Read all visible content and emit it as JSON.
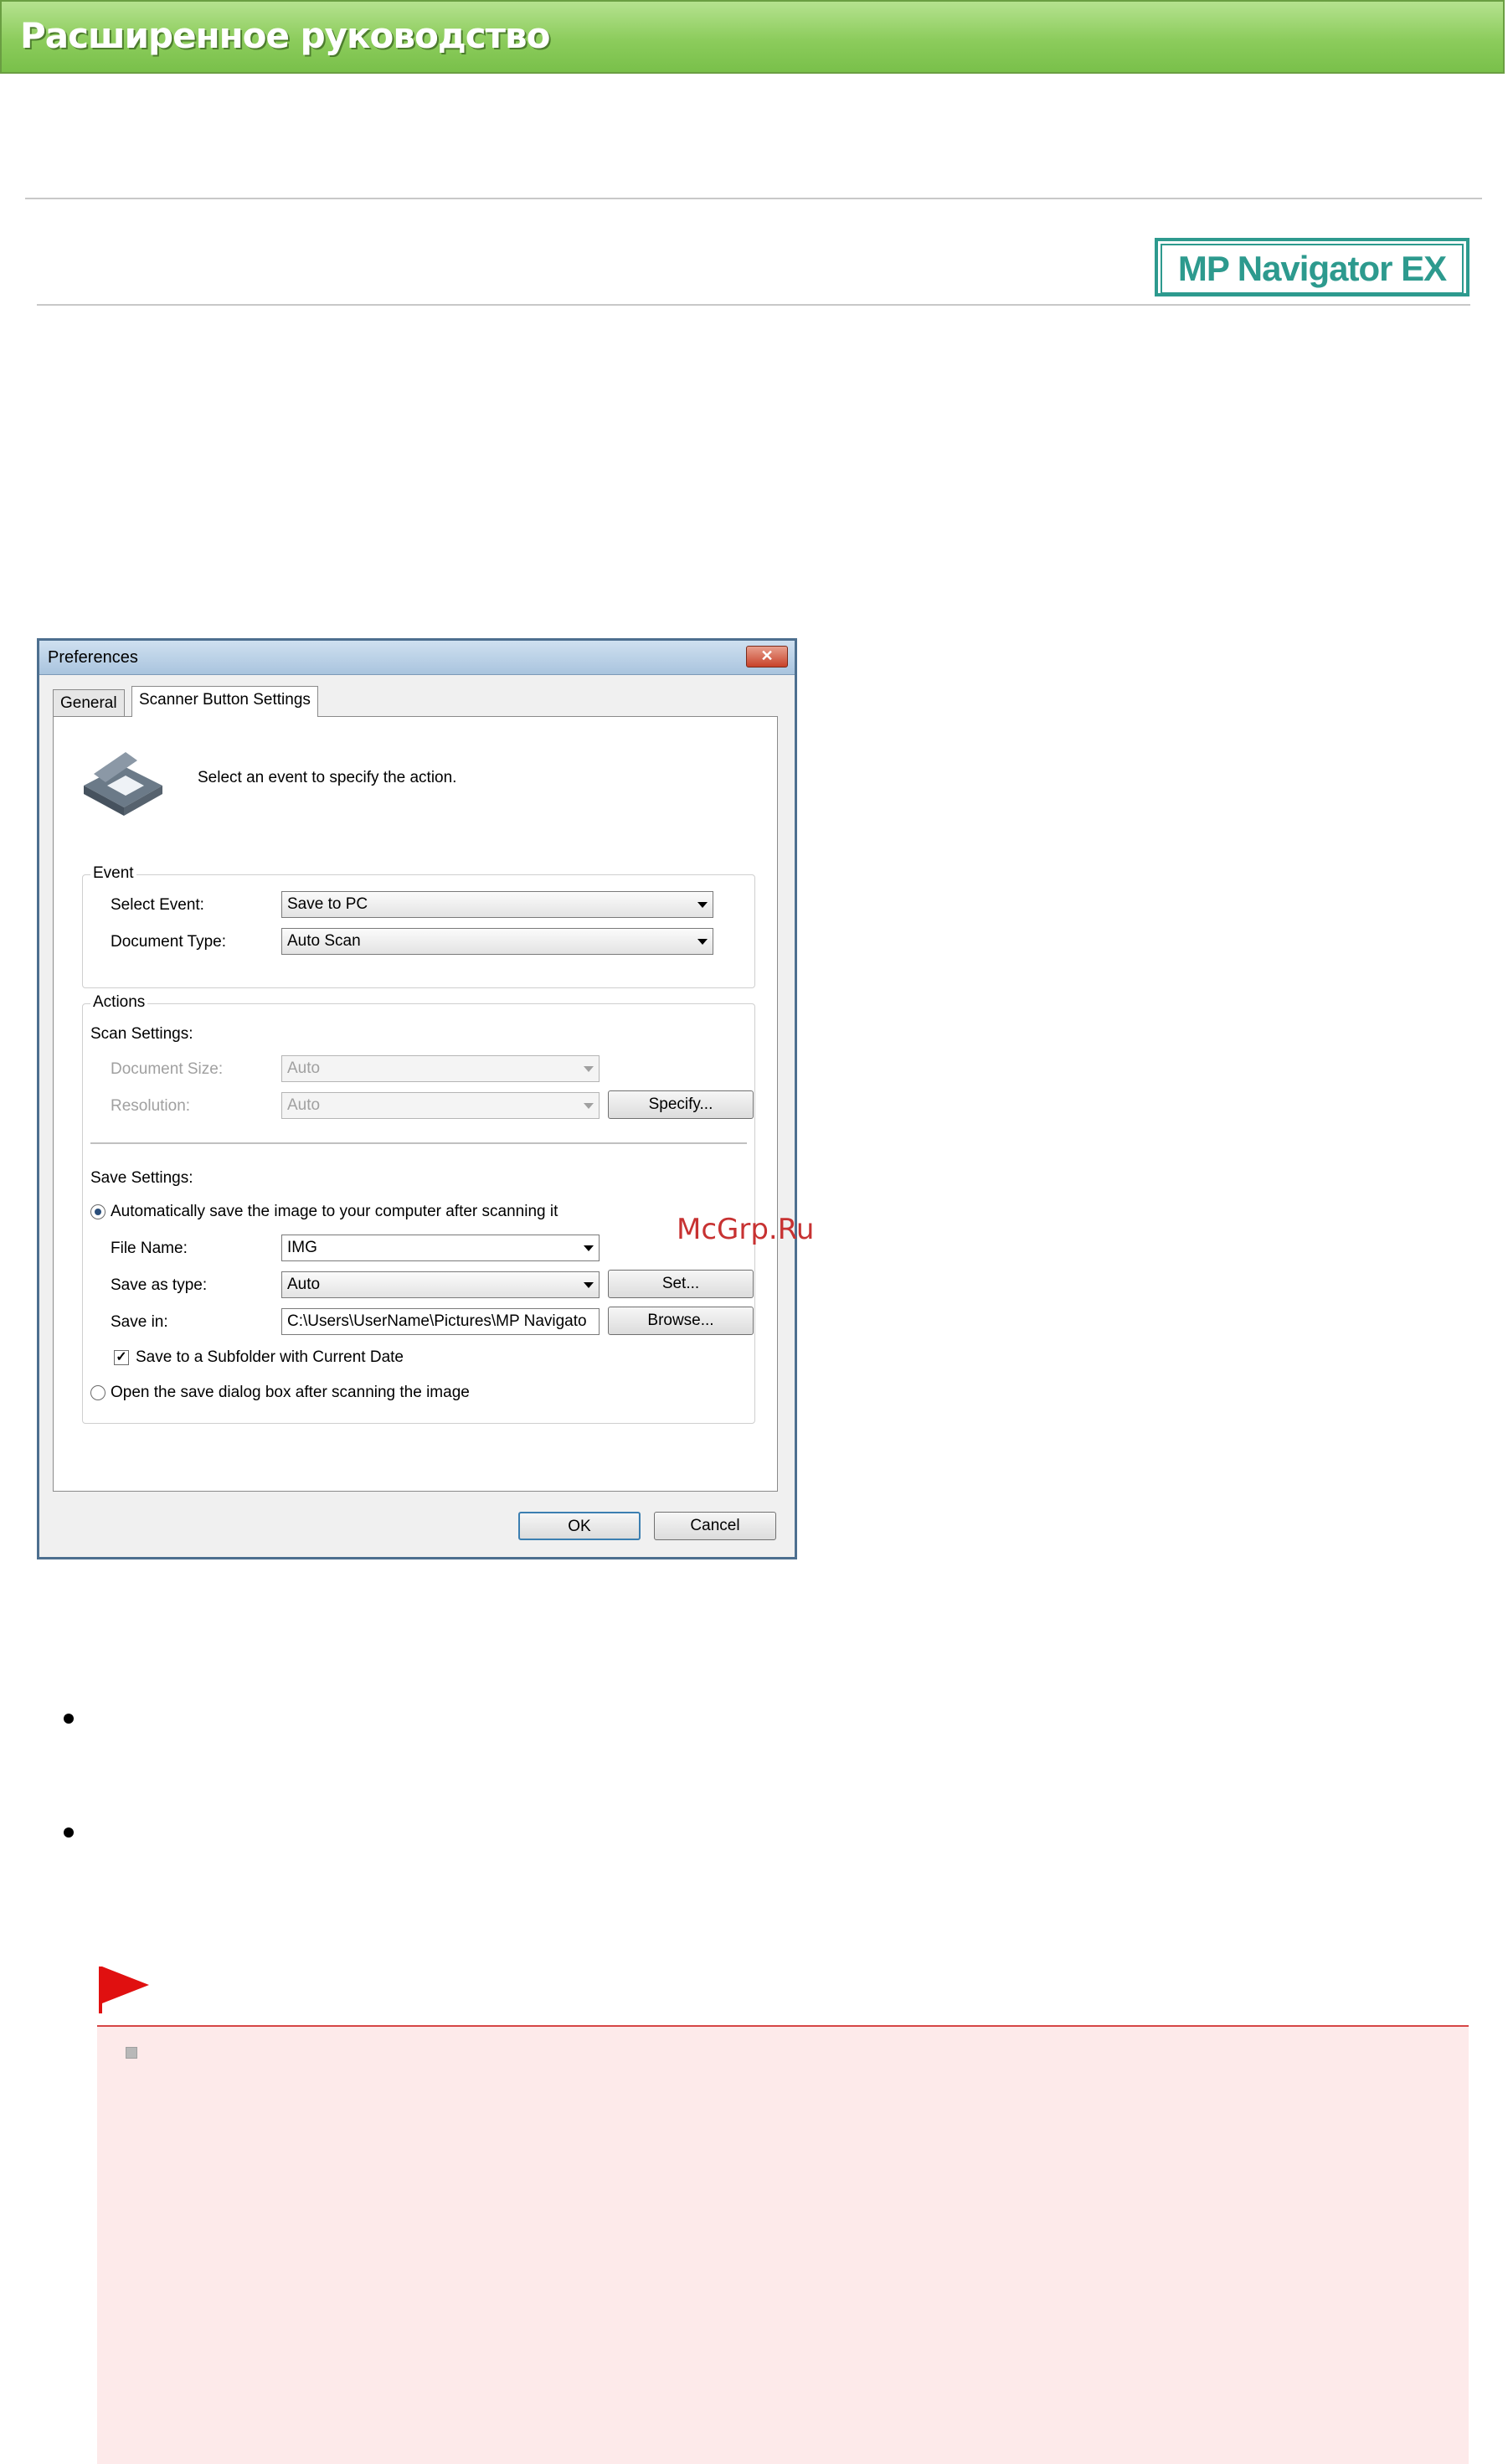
{
  "header": {
    "title": "Расширенное руководство"
  },
  "logo": {
    "text": "MP Navigator EX"
  },
  "dialog": {
    "title": "Preferences",
    "close_glyph": "✕",
    "tabs": [
      "General",
      "Scanner Button Settings"
    ],
    "intro_text": "Select an event to specify the action.",
    "event": {
      "legend": "Event",
      "select_event_label": "Select Event:",
      "select_event_value": "Save to PC",
      "document_type_label": "Document Type:",
      "document_type_value": "Auto Scan"
    },
    "actions": {
      "legend": "Actions",
      "scan_settings_label": "Scan Settings:",
      "document_size_label": "Document Size:",
      "document_size_value": "Auto",
      "resolution_label": "Resolution:",
      "resolution_value": "Auto",
      "specify_button": "Specify...",
      "save_settings_label": "Save Settings:",
      "auto_save_radio": "Automatically save the image to your computer after scanning it",
      "file_name_label": "File Name:",
      "file_name_value": "IMG",
      "save_as_type_label": "Save as type:",
      "save_as_type_value": "Auto",
      "set_button": "Set...",
      "save_in_label": "Save in:",
      "save_in_value": "C:\\Users\\UserName\\Pictures\\MP Navigato",
      "browse_button": "Browse...",
      "subfolder_checkbox": "Save to a Subfolder with Current Date",
      "open_dialog_radio": "Open the save dialog box after scanning the image"
    },
    "ok_button": "OK",
    "cancel_button": "Cancel"
  },
  "watermark": "McGrp.Ru",
  "colors": {
    "header_green": "#8ccc5c",
    "logo_teal": "#2d9a8e",
    "note_background": "#fdeaea",
    "note_rule": "#d64545",
    "flag_red": "#e01010"
  }
}
